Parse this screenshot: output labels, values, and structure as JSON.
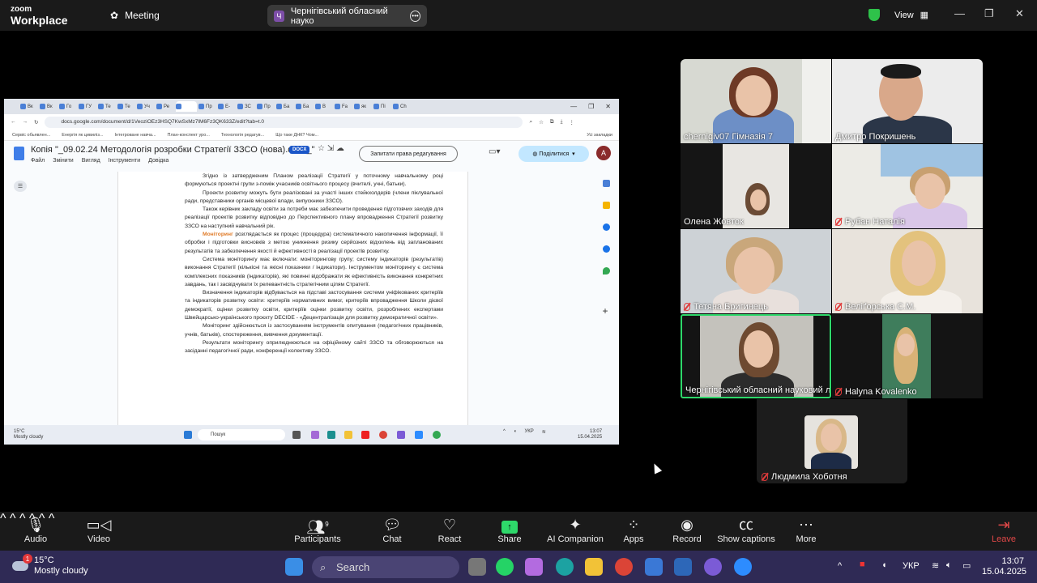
{
  "zoom": {
    "brand_top": "zoom",
    "brand_bottom": "Workplace",
    "meeting_label": "Meeting",
    "share_avatar": "Ч",
    "share_title": "Чернігівський обласний науко",
    "view_label": "View",
    "colors": {
      "active_speaker": "#2ed86a",
      "secure": "#2ec24a",
      "muted": "#e03b3b"
    }
  },
  "browser": {
    "tabs": [
      "Вк",
      "Вк",
      "Го",
      "ГУ",
      "Те",
      "Те",
      "Уч",
      "Ре",
      "",
      "Пр",
      "Е-",
      "ЗС",
      "Пр",
      "Ба",
      "Ба",
      "В",
      "Fa",
      "як",
      "Пі",
      "Ch"
    ],
    "url": "docs.google.com/document/d/1VeoziOEz3HSQ7KwSxMz7lM6Fz3QK633Z/edit?tab=t.0",
    "bookmarks": [
      "Сервіс обьявлен...",
      "Енергія як цивиліз...",
      "Інтегроване навча...",
      "План-конспект уро...",
      "Технологія редагув...",
      "Що таке ДНК? Чом..."
    ],
    "bookmarks_all": "Усі закладки",
    "doc_title": "Копія \"_09.02.24 Методологія розробки Стратегії ЗЗСО (нова).docx_\"",
    "docx_badge": "DOCX",
    "menu": [
      "Файл",
      "Змінити",
      "Вигляд",
      "Інструменти",
      "Довідка"
    ],
    "ask_edit": "Запитати права редагування",
    "share_btn": "Поділитися",
    "user_initial": "A"
  },
  "doc": {
    "p1": "Згідно із затвердженим Планом реалізації Стратегії у поточному навчальному році формуються проектні групи з-поміж учасників освітнього процесу (вчителі, учні, батьки).",
    "p2": "Проекти розвитку можуть бути реалізовані за участі інших стейкхолдерів (члени піклувальної ради, представники органів місцевої влади, випускники ЗЗСО).",
    "p3": "Також керівник закладу освіти за потреби має забезпечити проведення підготовчих заходів для реалізації проектів розвитку відповідно до Перспективного плану впровадження Стратегії розвитку ЗЗСО на наступний навчальний рік.",
    "p4_hl": "Моніторинг",
    "p4": " розглядається як процес (процедура) систематичного накопичення інформації, її обробки і підготовки висновків з метою уникнення ризику серйозних відхилень від запланованих результатів та забезпечення якості й ефективності в реалізації проектів розвитку.",
    "p5": "Система моніторингу має включати: моніторингову групу; систему індикаторів (результатів) виконання Стратегії (кількісні та якісні показники / індикатори). Інструментом моніторингу є система комплексних показників (індикаторів), які повинні відображати як ефективність виконання конкретних завдань, так і засвідчувати їх релевантність стратегічним цілям Стратегії.",
    "p6": "Визначення індикаторів відбувається на підставі застосування системи уніфікованих критеріїв та індикаторів розвитку освіти: критеріїв нормативних вимог, критеріїв впровадження Школи дієвої демократії, оцінки розвитку освіти, критеріїв оцінки розвитку освіти, розроблених експертами Швейцарсько-українського проєкту DECIDE - «Децентралізація для розвитку демократичної освіти».",
    "p7": "Моніторинг здійснюється із застосуванням інструментів опитування (педагогічних працівників, учнів, батьків), спостереження, вивчення документації.",
    "p8": "Результати моніторингу оприлюднюються на офіційному сайті ЗЗСО та обговорюються на засіданні педагогічної ради, конференції колективу ЗЗСО."
  },
  "inner_taskbar": {
    "temp": "15°C",
    "weather": "Mostly cloudy",
    "search": "Пошук",
    "lang": "УКР",
    "time": "13:07",
    "date": "15.04.2025"
  },
  "participants": [
    {
      "name": "chernigiv07 Гімназія 7",
      "muted": false
    },
    {
      "name": "Дмитро Покришень",
      "muted": false
    },
    {
      "name": "Олена Жовток",
      "muted": false
    },
    {
      "name": "Рубан Наталія",
      "muted": true
    },
    {
      "name": "Тетяна Бригинець",
      "muted": true
    },
    {
      "name": "Веліґорська С.М.",
      "muted": true
    },
    {
      "name": "Чернігівський обласний науковий лі...",
      "muted": false
    },
    {
      "name": "Halyna Kovalenko",
      "muted": true
    },
    {
      "name": "Людмила Хоботня",
      "muted": true
    }
  ],
  "toolbar": {
    "audio": "Audio",
    "video": "Video",
    "participants": "Participants",
    "participants_count": "9",
    "chat": "Chat",
    "react": "React",
    "share": "Share",
    "ai": "AI Companion",
    "apps": "Apps",
    "record": "Record",
    "captions": "Show captions",
    "more": "More",
    "leave": "Leave"
  },
  "taskbar": {
    "badge": "1",
    "temp": "15°C",
    "weather": "Mostly cloudy",
    "search": "Search",
    "lang": "УКР",
    "time": "13:07",
    "date": "15.04.2025"
  }
}
